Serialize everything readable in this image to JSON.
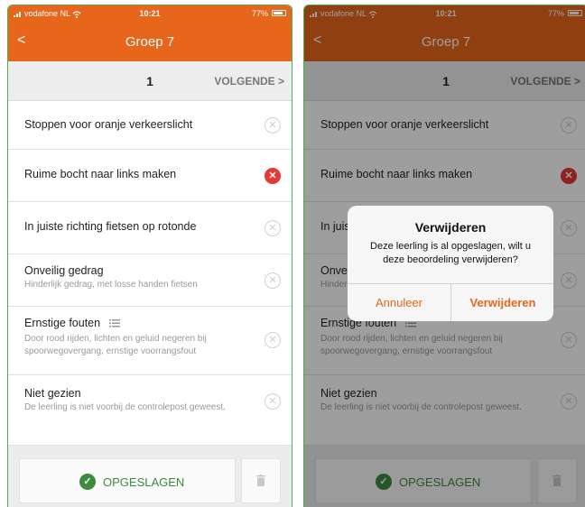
{
  "status_bar": {
    "carrier": "vodafone NL",
    "time": "10:21",
    "battery": "77%"
  },
  "nav": {
    "back": "<",
    "title": "Groep 7"
  },
  "pager": {
    "page": "1",
    "next_label": "VOLGENDE >"
  },
  "items": [
    {
      "label": "Stoppen voor oranje verkeerslicht",
      "sub": "",
      "selected": false
    },
    {
      "label": "Ruime bocht naar links maken",
      "sub": "",
      "selected": true
    },
    {
      "label": "In juiste richting fietsen op rotonde",
      "sub": "",
      "selected": false
    },
    {
      "label": "Onveilig gedrag",
      "sub": "Hinderlijk gedrag, met losse handen fietsen",
      "selected": false
    },
    {
      "label": "Ernstige fouten",
      "sub": "Door rood rijden, lichten en geluid negeren bij spoorwegovergang, ernstige voorrangsfout",
      "selected": false
    },
    {
      "label": "Niet gezien",
      "sub": "De leerling is niet voorbij de controlepost geweest.",
      "selected": false
    }
  ],
  "footer": {
    "save_label": "OPGESLAGEN"
  },
  "dialog": {
    "title": "Verwijderen",
    "message": "Deze leerling is al opgeslagen, wilt u deze beoordeling verwijderen?",
    "cancel": "Annuleer",
    "confirm": "Verwijderen"
  },
  "colors": {
    "accent": "#e8661c",
    "selected": "#e53935",
    "saved": "#3d8b3d",
    "frame": "#4caf50"
  }
}
